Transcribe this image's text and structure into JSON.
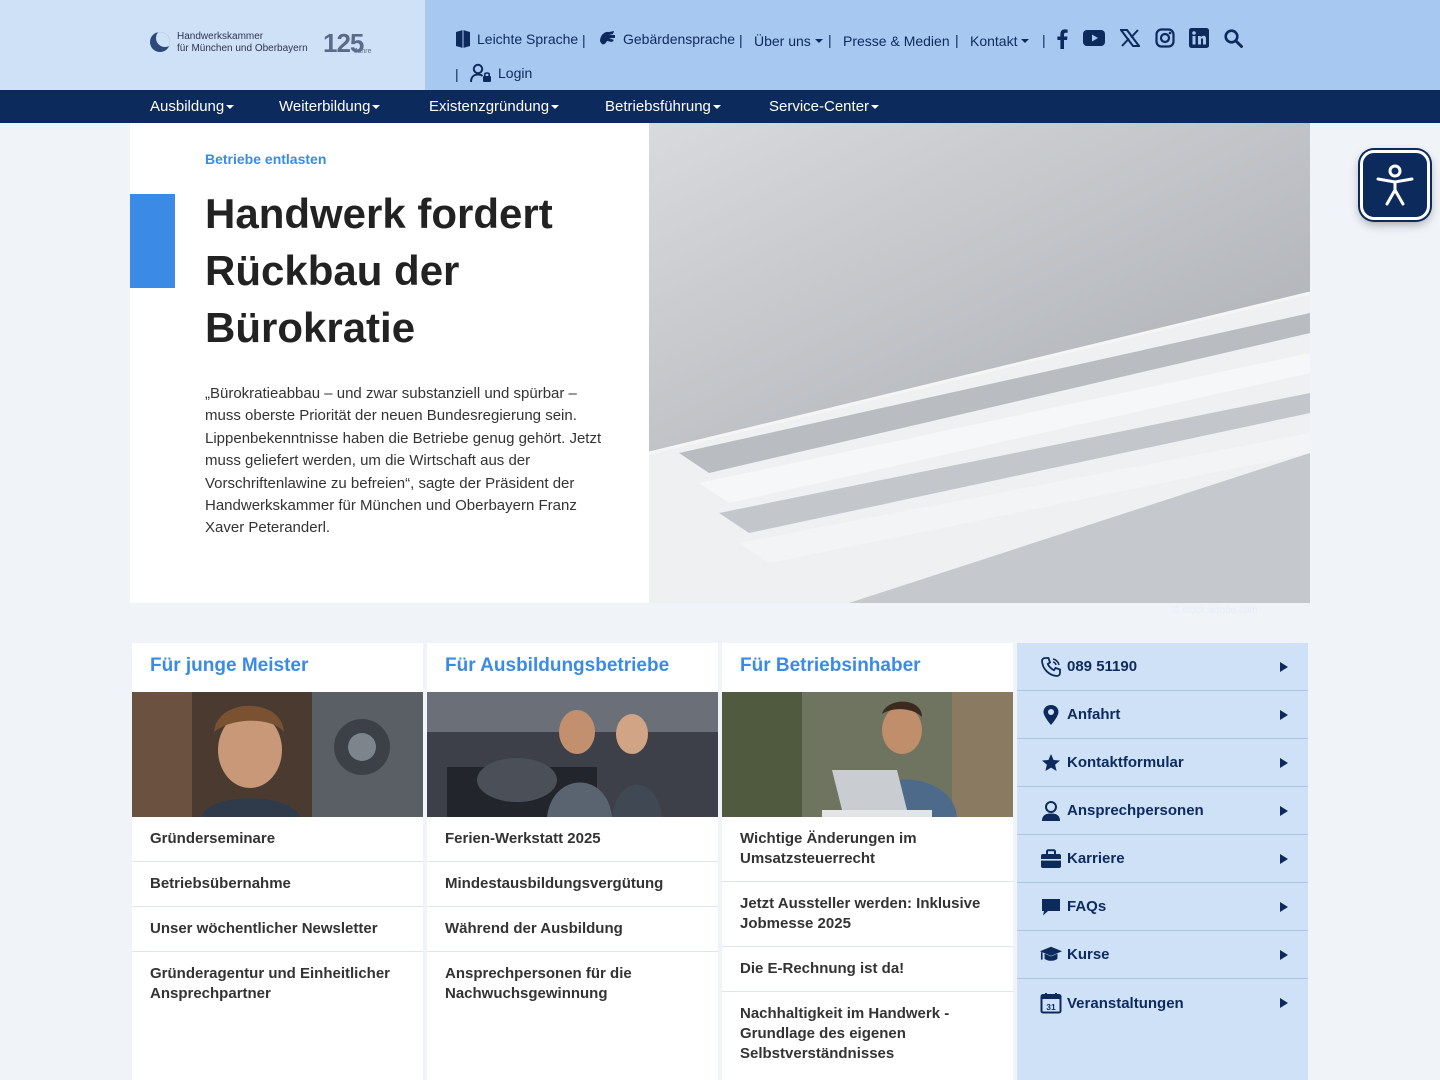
{
  "header": {
    "logo": {
      "line1": "Handwerkskammer",
      "line2": "für München und Oberbayern",
      "anniversary": "125",
      "anniversary_suffix": "Jahre"
    },
    "utility": [
      {
        "label": "Leichte Sprache",
        "icon": "book-icon"
      },
      {
        "label": "Gebärdensprache",
        "icon": "sign-language-icon"
      },
      {
        "label": "Über uns",
        "icon": "chevron-down-icon"
      },
      {
        "label": "Presse & Medien",
        "icon": ""
      },
      {
        "label": "Kontakt",
        "icon": "chevron-down-icon"
      },
      {
        "label": "Login",
        "icon": "user-lock-icon"
      }
    ],
    "social": [
      "facebook-icon",
      "youtube-icon",
      "x-icon",
      "instagram-icon",
      "linkedin-icon",
      "search-icon"
    ]
  },
  "nav": {
    "items": [
      "Ausbildung",
      "Weiterbildung",
      "Existenzgründung",
      "Betriebsführung",
      "Service-Center"
    ]
  },
  "hero": {
    "kicker": "Betriebe entlasten",
    "title": "Handwerk fordert Rückbau der Bürokratie",
    "text": "„Bürokratieabbau – und zwar substanziell und spürbar – muss oberste Priorität der neuen Bundesregierung sein. Lippenbekenntnisse haben die Betriebe genug gehört. Jetzt muss geliefert werden, um die Wirtschaft aus der Vorschriftenlawine zu befreien“, sagte der Präsident der Handwerkskammer für München und Oberbayern Franz Xaver Peteranderl.",
    "credit": "© stock.adobe.com"
  },
  "cards": [
    {
      "title": "Für junge Meister",
      "links": [
        "Gründerseminare",
        "Betriebsübernahme",
        "Unser wöchentlicher Newsletter",
        "Gründeragentur und Einheitlicher Ansprechpartner"
      ]
    },
    {
      "title": "Für Ausbildungsbetriebe",
      "links": [
        "Ferien-Werkstatt 2025",
        "Mindestausbildungsvergütung",
        "Während der Ausbildung",
        "Ansprechpersonen für die Nachwuchsgewinnung"
      ]
    },
    {
      "title": "Für Betriebsinhaber",
      "links": [
        "Wichtige Änderungen im Umsatzsteuerrecht",
        "Jetzt Aussteller werden: Inklusive Jobmesse 2025",
        "Die E-Rechnung ist da!",
        "Nachhaltigkeit im Handwerk - Grundlage des eigenen Selbstverständnisses"
      ]
    }
  ],
  "service": {
    "items": [
      {
        "label": "089 51190",
        "icon": "phone-icon"
      },
      {
        "label": "Anfahrt",
        "icon": "map-pin-icon"
      },
      {
        "label": "Kontaktformular",
        "icon": "star-icon"
      },
      {
        "label": "Ansprechpersonen",
        "icon": "person-icon"
      },
      {
        "label": "Karriere",
        "icon": "briefcase-icon"
      },
      {
        "label": "FAQs",
        "icon": "chat-icon"
      },
      {
        "label": "Kurse",
        "icon": "graduation-cap-icon"
      },
      {
        "label": "Veranstaltungen",
        "icon": "calendar-icon"
      }
    ],
    "calendar_day": "31"
  },
  "colors": {
    "navy": "#0d2a5c",
    "accent_blue": "#3b8be6",
    "header_blue": "#a7c8f0",
    "light_blue": "#cfe1f7"
  }
}
